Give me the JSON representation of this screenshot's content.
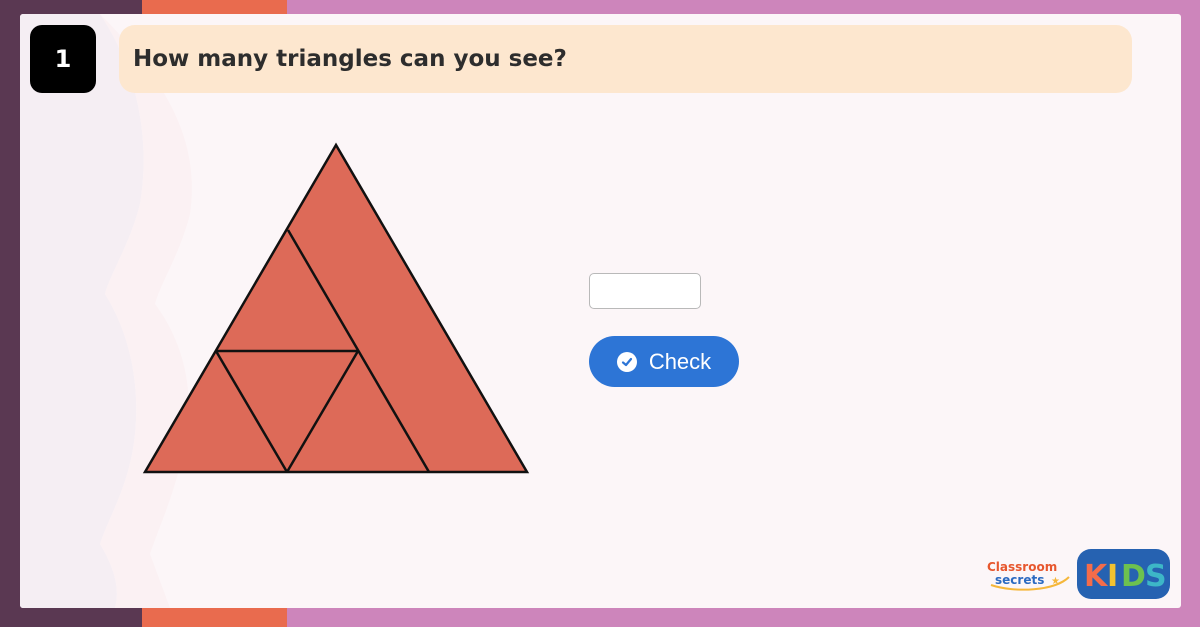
{
  "question": {
    "number": "1",
    "text": "How many triangles can you see?"
  },
  "answer": {
    "value": "",
    "placeholder": ""
  },
  "check_button": {
    "label": "Check",
    "icon": "check-circle-icon"
  },
  "logos": {
    "brand_line1": "Classroom",
    "brand_line2": "secrets",
    "kids": "KIDS"
  },
  "colors": {
    "triangle_fill": "#dd6a58",
    "button": "#2d75d6",
    "question_bar": "#fde7cf"
  }
}
